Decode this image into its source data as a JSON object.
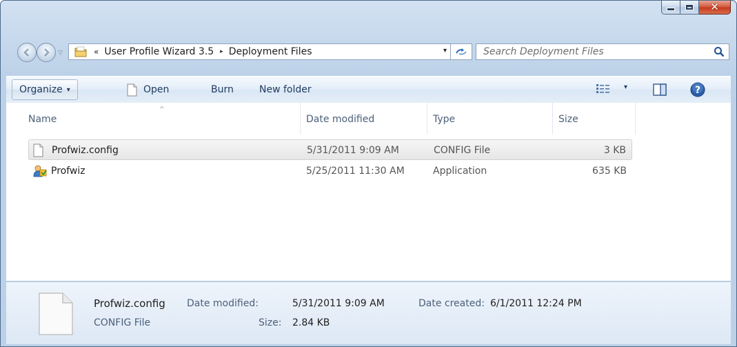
{
  "window": {
    "minimize_icon": "minimize-icon",
    "maximize_icon": "maximize-icon",
    "close_glyph": "✕"
  },
  "address_bar": {
    "overflow_chevrons": "«",
    "crumbs": [
      "User Profile Wizard 3.5",
      "Deployment Files"
    ],
    "separator": "▸",
    "dropdown": "▾"
  },
  "search": {
    "placeholder": "Search Deployment Files"
  },
  "commands": {
    "organize": "Organize",
    "open": "Open",
    "burn": "Burn",
    "new_folder": "New folder",
    "caret": "▾"
  },
  "columns": {
    "name": "Name",
    "date_modified": "Date modified",
    "type": "Type",
    "size": "Size",
    "sort_arrow": "^"
  },
  "files": [
    {
      "name": "Profwiz.config",
      "date": "5/31/2011 9:09 AM",
      "type": "CONFIG File",
      "size": "3 KB",
      "icon": "document-icon",
      "selected": true
    },
    {
      "name": "Profwiz",
      "date": "5/25/2011 11:30 AM",
      "type": "Application",
      "size": "635 KB",
      "icon": "application-icon",
      "selected": false
    }
  ],
  "details": {
    "name": "Profwiz.config",
    "type": "CONFIG File",
    "date_modified_label": "Date modified:",
    "date_modified": "5/31/2011 9:09 AM",
    "size_label": "Size:",
    "size": "2.84 KB",
    "date_created_label": "Date created:",
    "date_created": "6/1/2011 12:24 PM"
  },
  "colors": {
    "frame": "#c6d8ec",
    "close_button": "#c4381a",
    "selection": "#e6e6e6"
  }
}
